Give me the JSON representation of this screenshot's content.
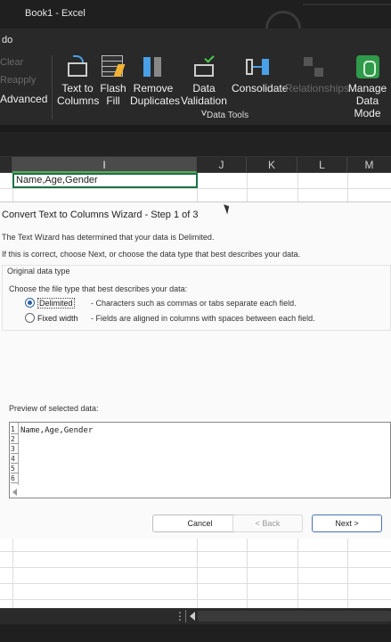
{
  "window": {
    "title": "Book1 - Excel"
  },
  "ribbon": {
    "undo_label": "do",
    "clear_label": "Clear",
    "reapply_label": "Reapply",
    "advanced_label": "Advanced",
    "buttons": [
      {
        "label": "Text to\nColumns",
        "icon": "text-to-columns-icon"
      },
      {
        "label": "Flash\nFill",
        "icon": "flash-fill-icon"
      },
      {
        "label": "Remove\nDuplicates",
        "icon": "remove-duplicates-icon"
      },
      {
        "label": "Data\nValidation ˅",
        "icon": "data-validation-icon"
      },
      {
        "label": "Consolidate",
        "icon": "consolidate-icon"
      },
      {
        "label": "Relationships",
        "icon": "relationships-icon"
      },
      {
        "label": "Manage\nData Mode",
        "icon": "manage-data-model-icon"
      }
    ],
    "group_label": "Data Tools"
  },
  "sheet": {
    "columns": [
      "I",
      "J",
      "K",
      "L",
      "M"
    ],
    "active_cell_value": "Name,Age,Gender"
  },
  "wizard": {
    "title": "Convert Text to Columns Wizard - Step 1 of 3",
    "intro_1": "The Text Wizard has determined that your data is Delimited.",
    "intro_2": "If this is correct, choose Next, or choose the data type that best describes your data.",
    "original_data_type": "Original data type",
    "choose_label": "Choose the file type that best describes your data:",
    "options": [
      {
        "label": "Delimited",
        "desc": "- Characters such as commas or tabs separate each field.",
        "selected": true
      },
      {
        "label": "Fixed width",
        "desc": "- Fields are aligned in columns with spaces between each field.",
        "selected": false
      }
    ],
    "preview_label": "Preview of selected data:",
    "preview_rows": [
      "1",
      "2",
      "3",
      "4",
      "5",
      "6"
    ],
    "preview_line": "Name,Age,Gender",
    "buttons": {
      "cancel": "Cancel",
      "back": "< Back",
      "next": "Next >"
    }
  },
  "statusbar": {
    "dots": "⋮"
  }
}
